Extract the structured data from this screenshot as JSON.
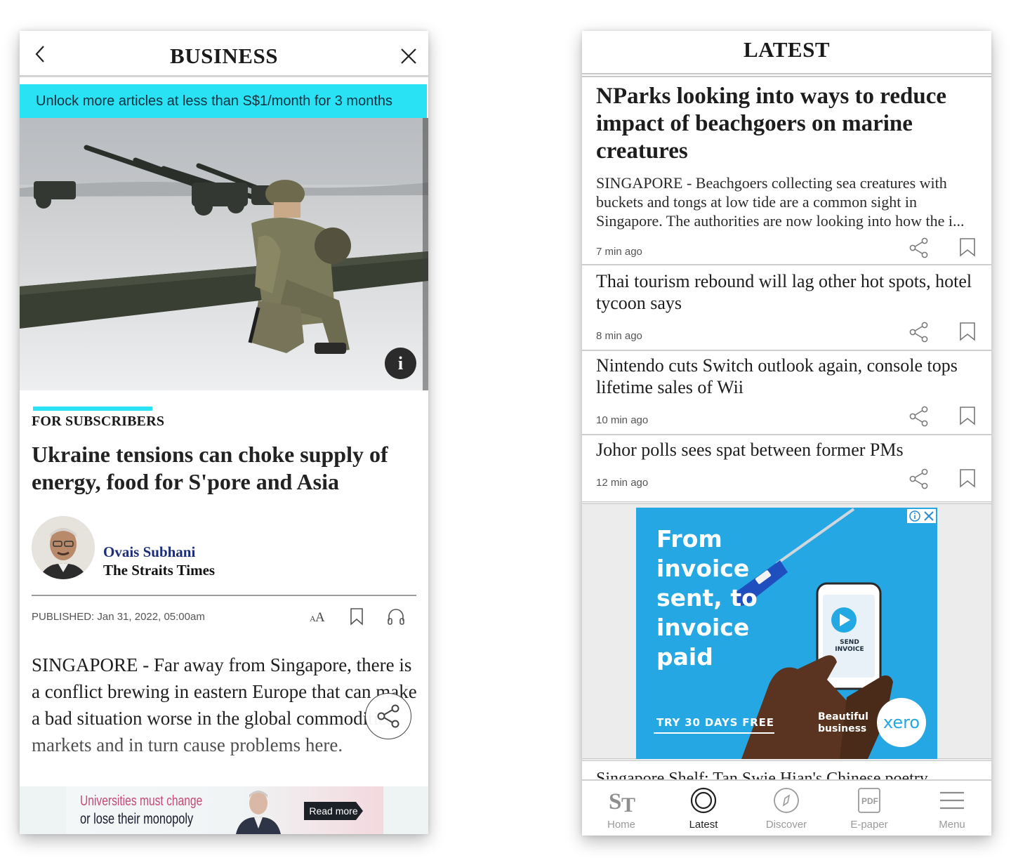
{
  "left": {
    "header": {
      "title": "BUSINESS",
      "back_icon": "chevron-left-icon",
      "close_icon": "close-icon"
    },
    "promo_banner": "Unlock more articles at less than S$1/month for 3 months",
    "hero_image": {
      "info_label": "i"
    },
    "article": {
      "section_label": "FOR SUBSCRIBERS",
      "headline": "Ukraine tensions can choke supply of energy, food for S'pore and Asia",
      "author": "Ovais Subhani",
      "outlet": "The Straits Times",
      "published": "PUBLISHED: Jan 31, 2022, 05:00am",
      "text_size_label": "AA",
      "body": "SINGAPORE - Far away from Singapore, there is a conflict brewing in eastern Europe that can make a bad situation worse in the global commodities markets and in turn cause problems here."
    },
    "bottom_ad": {
      "line1": "Universities must change",
      "line2": "or lose their monopoly",
      "button": "Read more"
    }
  },
  "right": {
    "header": {
      "title": "LATEST"
    },
    "stories": [
      {
        "title": "NParks looking into ways to reduce impact of beachgoers on marine creatures",
        "summary": "SINGAPORE - Beachgoers collecting sea creatures with buckets and tongs at low tide are a common sight in Singapore. The authorities are now looking into how the i...",
        "time": "7 min ago"
      },
      {
        "title": "Thai tourism rebound will lag other hot spots, hotel tycoon says",
        "time": "8 min ago"
      },
      {
        "title": "Nintendo cuts Switch outlook again, console tops lifetime sales of Wii",
        "time": "10 min ago"
      },
      {
        "title": "Johor polls sees spat between former PMs",
        "time": "12 min ago"
      }
    ],
    "ad": {
      "headline": "From invoice sent, to invoice paid",
      "trial": "TRY 30 DAYS FREE",
      "tagline1": "Beautiful",
      "tagline2": "business",
      "brand": "xero",
      "phone_button": "SEND INVOICE"
    },
    "peek_headline": "Singapore Shelf: Tan Swie Hian's Chinese poetry",
    "tabs": [
      {
        "label": "Home",
        "icon": "st-logo-icon"
      },
      {
        "label": "Latest",
        "icon": "latest-ring-icon",
        "active": true
      },
      {
        "label": "Discover",
        "icon": "compass-icon"
      },
      {
        "label": "E-paper",
        "icon": "pdf-icon"
      },
      {
        "label": "Menu",
        "icon": "hamburger-menu-icon"
      }
    ]
  },
  "colors": {
    "accent_cyan": "#29e3f4",
    "author_blue": "#1c2e7a",
    "ad_blue": "#24a7e2"
  }
}
